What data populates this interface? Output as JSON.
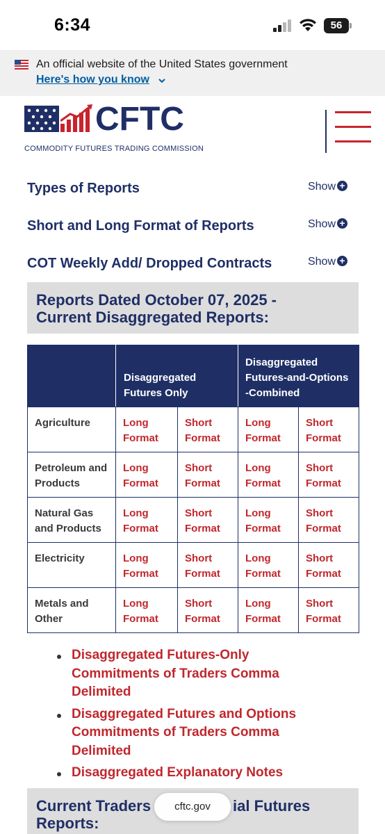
{
  "status_bar": {
    "time": "6:34",
    "battery": "56",
    "signal_icon": "cellular-signal-icon",
    "wifi_icon": "wifi-icon"
  },
  "gov_banner": {
    "text": "An official website of the United States government",
    "link": "Here's how you know",
    "flag_icon": "us-flag-icon"
  },
  "header": {
    "logo_word": "CFTC",
    "logo_sub": "COMMODITY FUTURES TRADING COMMISSION",
    "menu_icon": "hamburger-menu-icon"
  },
  "accordions": [
    {
      "title": "Types of Reports",
      "toggle": "Show"
    },
    {
      "title": "Short and Long Format of Reports",
      "toggle": "Show"
    },
    {
      "title": "COT Weekly Add/ Dropped Contracts",
      "toggle": "Show"
    }
  ],
  "section": {
    "title_line1": "Reports Dated October 07, 2025 -",
    "title_line2": "Current Disaggregated Reports:"
  },
  "table": {
    "headers": {
      "futures_only": "Disaggregated Futures Only",
      "futures_options": "Disaggregated Futures-and-Options -Combined"
    },
    "rows": [
      {
        "category": "Agriculture",
        "cells": [
          "Long Format",
          "Short Format",
          "Long Format",
          "Short Format"
        ]
      },
      {
        "category": "Petroleum and Products",
        "cells": [
          "Long Format",
          "Short Format",
          "Long Format",
          "Short Format"
        ]
      },
      {
        "category": "Natural Gas and Products",
        "cells": [
          "Long Format",
          "Short Format",
          "Long Format",
          "Short Format"
        ]
      },
      {
        "category": "Electricity",
        "cells": [
          "Long Format",
          "Short Format",
          "Long Format",
          "Short Format"
        ]
      },
      {
        "category": "Metals and Other",
        "cells": [
          "Long Format",
          "Short Format",
          "Long Format",
          "Short Format"
        ]
      }
    ]
  },
  "links": [
    "Disaggregated Futures-Only Commitments of Traders Comma Delimited",
    "Disaggregated Futures and Options Commitments of Traders Comma Delimited",
    "Disaggregated Explanatory Notes"
  ],
  "next_section": {
    "title_line1_a": "Current Traders",
    "title_line1_b": "ial Futures",
    "title_line2": "Reports:"
  },
  "url_bar": {
    "domain": "cftc.gov"
  },
  "colors": {
    "navy": "#1f2f66",
    "red": "#c0272d",
    "banner_gray": "#f0f0f0",
    "section_gray": "#dddddd"
  }
}
